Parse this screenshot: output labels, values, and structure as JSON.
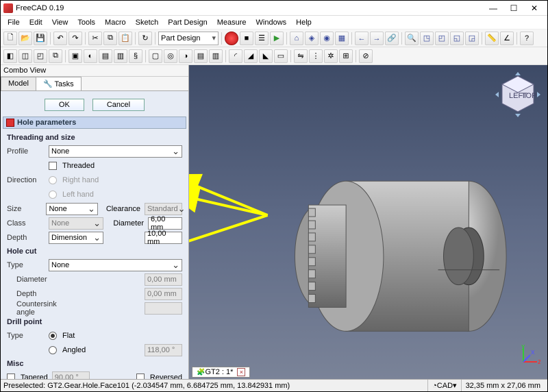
{
  "window": {
    "title": "FreeCAD 0.19"
  },
  "menus": [
    "File",
    "Edit",
    "View",
    "Tools",
    "Macro",
    "Sketch",
    "Part Design",
    "Measure",
    "Windows",
    "Help"
  ],
  "workbench": "Part Design",
  "combo": {
    "title": "Combo View",
    "tab_model": "Model",
    "tab_tasks": "Tasks",
    "ok": "OK",
    "cancel": "Cancel",
    "panel_header": "Hole parameters",
    "threading_size": "Threading and size",
    "profile": "Profile",
    "profile_val": "None",
    "threaded": "Threaded",
    "direction": "Direction",
    "right_hand": "Right hand",
    "left_hand": "Left hand",
    "size": "Size",
    "size_val": "None",
    "clearance": "Clearance",
    "clearance_val": "Standard",
    "class": "Class",
    "class_val": "None",
    "diameter": "Diameter",
    "diameter_val": "6,00 mm",
    "depth": "Depth",
    "depth_sel": "Dimension",
    "depth_val": "10,00 mm",
    "hole_cut": "Hole cut",
    "type": "Type",
    "holecut_type": "None",
    "hc_diameter": "Diameter",
    "hc_diameter_val": "0,00 mm",
    "hc_depth": "Depth",
    "hc_depth_val": "0,00 mm",
    "countersink": "Countersink angle",
    "countersink_val": "",
    "drill_point": "Drill point",
    "dp_flat": "Flat",
    "dp_angled": "Angled",
    "dp_angle_val": "118,00 °",
    "misc": "Misc",
    "tapered": "Tapered",
    "tapered_val": "90,00 °",
    "reversed": "Reversed"
  },
  "doc_tab": "GT2 : 1*",
  "status": {
    "presel": "Preselected: GT2.Gear.Hole.Face101 (-2.034547 mm, 6.684725 mm, 13.842931 mm)",
    "dims": "32,35 mm x 27,06 mm",
    "cad": "CAD"
  }
}
